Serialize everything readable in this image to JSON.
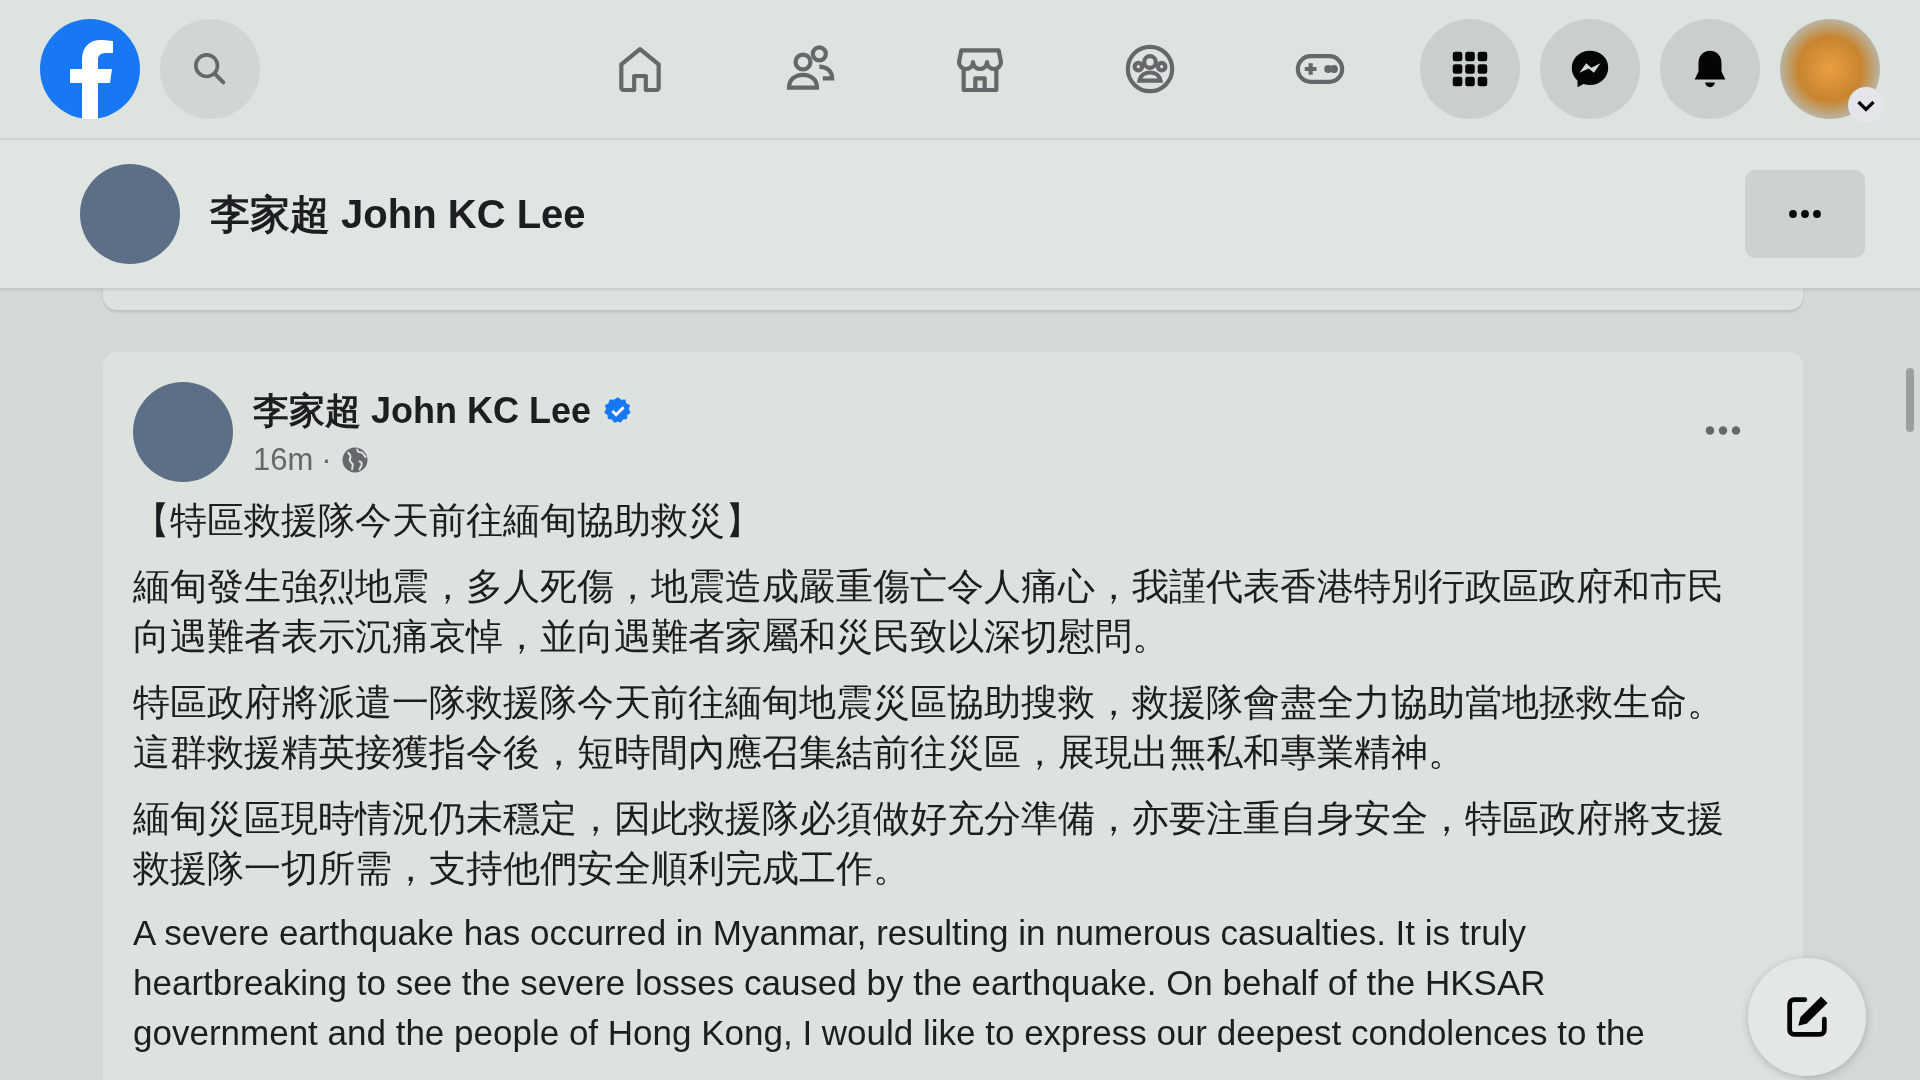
{
  "top_bar": {
    "nav_items": [
      {
        "kind": "home"
      },
      {
        "kind": "friends"
      },
      {
        "kind": "marketplace"
      },
      {
        "kind": "groups"
      },
      {
        "kind": "gaming"
      }
    ],
    "actions": [
      {
        "kind": "menu"
      },
      {
        "kind": "messenger"
      },
      {
        "kind": "notifications"
      }
    ]
  },
  "page_header": {
    "name": "李家超 John KC Lee"
  },
  "post": {
    "author": "李家超 John KC Lee",
    "verified": true,
    "time": "16m",
    "separator": "·",
    "title": "【特區救援隊今天前往緬甸協助救災】",
    "paragraphs": [
      {
        "kind": "zh",
        "text": "緬甸發生強烈地震，多人死傷，地震造成嚴重傷亡令人痛心，我謹代表香港特別行政區政府和市民向遇難者表示沉痛哀悼，並向遇難者家屬和災民致以深切慰問。"
      },
      {
        "kind": "zh",
        "text": "特區政府將派遣一隊救援隊今天前往緬甸地震災區協助搜救，救援隊會盡全力協助當地拯救生命。這群救援精英接獲指令後，短時間內應召集結前往災區，展現出無私和專業精神。"
      },
      {
        "kind": "zh",
        "text": "緬甸災區現時情況仍未穩定，因此救援隊必須做好充分準備，亦要注重自身安全，特區政府將支援救援隊一切所需，支持他們安全順利完成工作。"
      },
      {
        "kind": "en",
        "text": "A severe earthquake has occurred in Myanmar, resulting in numerous casualties. It is truly heartbreaking to see the severe losses caused by the earthquake. On behalf of the HKSAR government and the people of Hong Kong, I would like to express our deepest condolences to the"
      }
    ]
  }
}
